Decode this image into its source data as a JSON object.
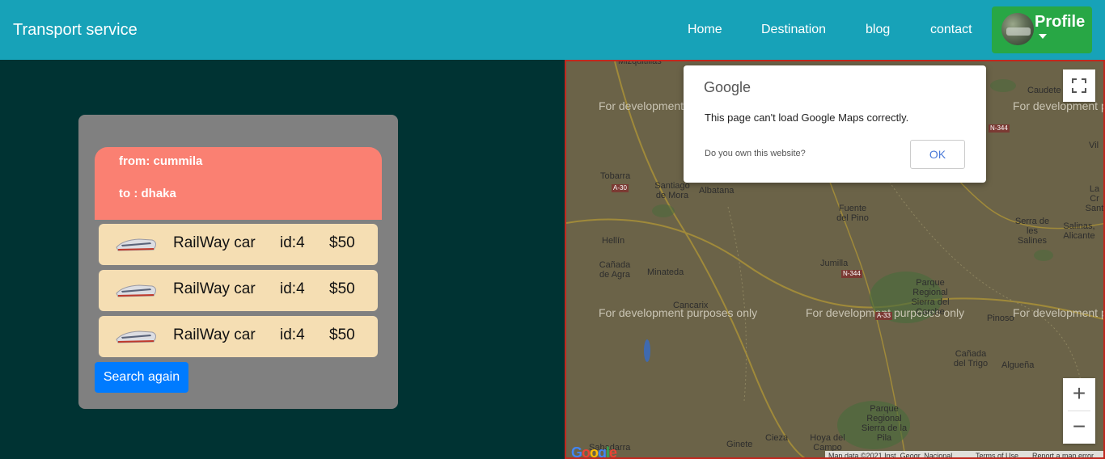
{
  "navbar": {
    "brand": "Transport service",
    "links": [
      "Home",
      "Destination",
      "blog",
      "contact"
    ],
    "profile_label": "Profile"
  },
  "route": {
    "from": "from: cummila",
    "to": "to : dhaka"
  },
  "vehicles": [
    {
      "name": "RailWay car",
      "id": "id:4",
      "price": "$50",
      "icon": "train-icon"
    },
    {
      "name": "RailWay car",
      "id": "id:4",
      "price": "$50",
      "icon": "train-icon"
    },
    {
      "name": "RailWay car",
      "id": "id:4",
      "price": "$50",
      "icon": "train-icon"
    }
  ],
  "search_again_label": "Search again",
  "map": {
    "dev_text": "For development purposes only",
    "places": [
      "Mizquitillas",
      "Caudete",
      "Vil",
      "Tobarra",
      "Santiago de Mora",
      "Albatana",
      "Fuente del Pino",
      "La Cr Sant",
      "Serra de les Salines",
      "Salinas, Alicante",
      "Hellín",
      "Cañada de Agra",
      "Minateda",
      "Jumilla",
      "Parque Regional Sierra del Carche",
      "Cancarix",
      "Pinoso",
      "Cañada del Trigo",
      "Algueña",
      "Parque Regional Sierra de la Pila",
      "Ginete",
      "Cieza",
      "Hoya del Campo",
      "Sabadarra"
    ],
    "road_shields": [
      "A-30",
      "N-344",
      "N-344",
      "A-33"
    ],
    "footer": {
      "map_data": "Map data ©2021 Inst. Geogr. Nacional",
      "terms": "Terms of Use",
      "report": "Report a map error"
    },
    "google_logo": "Google"
  },
  "dialog": {
    "logo": "Google",
    "message": "This page can't load Google Maps correctly.",
    "own_site": "Do you own this website?",
    "ok_label": "OK"
  }
}
